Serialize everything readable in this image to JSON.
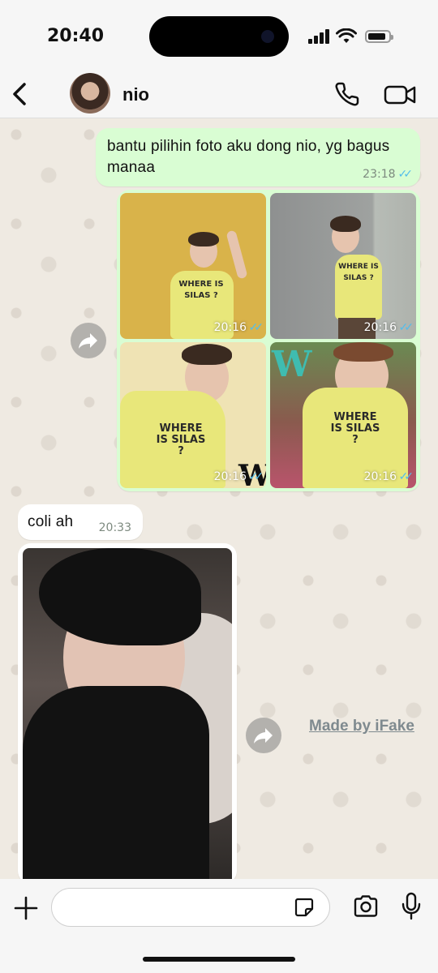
{
  "status_bar": {
    "time": "20:40"
  },
  "header": {
    "contact_name": "nio"
  },
  "messages": [
    {
      "direction": "outgoing",
      "type": "text",
      "text": "bantu pilihin foto aku dong nio, yg bagus manaa",
      "time": "23:18",
      "status": "read"
    },
    {
      "direction": "outgoing",
      "type": "photo_grid",
      "photos": [
        {
          "time": "20:16",
          "status": "read",
          "shirt_text": "WHERE IS SILAS ?"
        },
        {
          "time": "20:16",
          "status": "read",
          "shirt_text": "WHERE IS SILAS ?"
        },
        {
          "time": "20:16",
          "status": "read",
          "shirt_text": "WHERE IS SILAS ?"
        },
        {
          "time": "20:16",
          "status": "read",
          "shirt_text": "WHERE IS SILAS ?"
        }
      ]
    },
    {
      "direction": "incoming",
      "type": "text",
      "text": "coli ah",
      "time": "20:33"
    },
    {
      "direction": "incoming",
      "type": "photo"
    }
  ],
  "photo_letter": "W",
  "watermark": "Made by iFake",
  "icons": {
    "back": "chevron-left-icon",
    "call": "phone-icon",
    "video": "video-camera-icon",
    "forward": "forward-arrow-icon",
    "plus": "plus-icon",
    "sticker": "sticker-icon",
    "camera": "camera-icon",
    "mic": "microphone-icon"
  },
  "colors": {
    "outgoing_bubble": "#d9fdd3",
    "incoming_bubble": "#ffffff",
    "read_ticks": "#53bdeb",
    "chat_background": "#efeae2"
  },
  "composer": {
    "value": "",
    "placeholder": ""
  }
}
